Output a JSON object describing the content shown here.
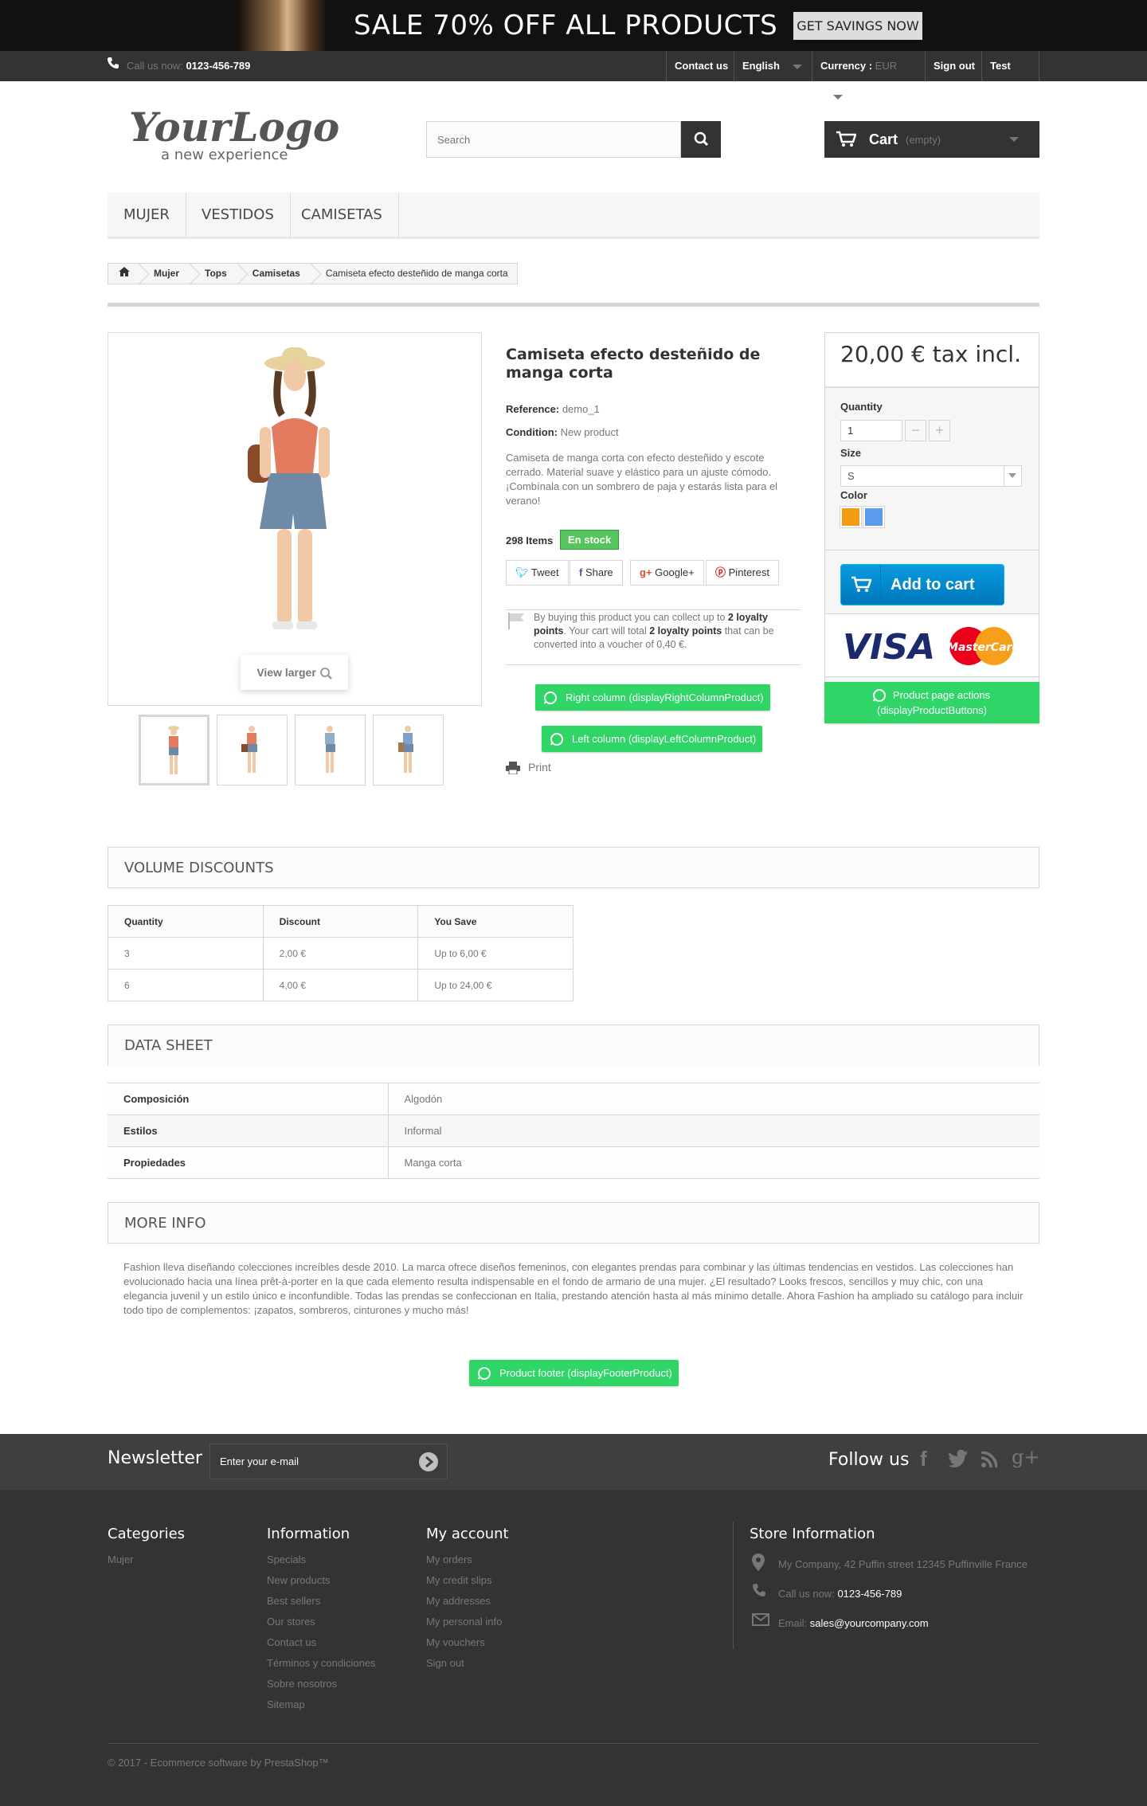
{
  "banner": {
    "text": "SALE 70% OFF ALL PRODUCTS",
    "button": "GET SAVINGS NOW"
  },
  "topbar": {
    "call_label": "Call us now:",
    "phone": "0123-456-789",
    "contact": "Contact us",
    "language": "English",
    "currency_label": "Currency :",
    "currency_value": "EUR",
    "signout": "Sign out",
    "user": "Test Test"
  },
  "header": {
    "logo_main": "YourLogo",
    "logo_tagline": "a new experience",
    "search_placeholder": "Search",
    "cart_label": "Cart",
    "cart_status": "(empty)"
  },
  "menu": [
    "MUJER",
    "VESTIDOS",
    "CAMISETAS"
  ],
  "breadcrumb": [
    "Mujer",
    "Tops",
    "Camisetas",
    "Camiseta efecto desteñido de manga corta"
  ],
  "product": {
    "title": "Camiseta efecto desteñido de manga corta",
    "reference_label": "Reference:",
    "reference": "demo_1",
    "condition_label": "Condition:",
    "condition": "New product",
    "description": "Camiseta de manga corta con efecto desteñido y escote cerrado. Material suave y elástico para un ajuste cómodo. ¡Combínala con un sombrero de paja y estarás lista para el verano!",
    "items": "298 Items",
    "stock": "En stock",
    "share": [
      "Tweet",
      "Share",
      "Google+",
      "Pinterest"
    ],
    "loyalty_1": "By buying this product you can collect up to",
    "loyalty_points1": "2 loyalty points",
    "loyalty_2": ". Your cart will total",
    "loyalty_points2": "2 loyalty points",
    "loyalty_3": "that can be converted into a voucher of 0,40 €.",
    "hook_right": "Right column (displayRightColumnProduct)",
    "hook_left": "Left column (displayLeftColumnProduct)",
    "print": "Print",
    "view_larger": "View larger"
  },
  "buybox": {
    "price": "20,00 € tax incl.",
    "quantity_label": "Quantity",
    "quantity": "1",
    "size_label": "Size",
    "size": "S",
    "color_label": "Color",
    "colors": [
      "#f39c11",
      "#5d9cec"
    ],
    "add_to_cart": "Add to cart",
    "hook_buttons_1": "Product page actions",
    "hook_buttons_2": "(displayProductButtons)",
    "visa": "VISA",
    "mastercard": "MasterCard"
  },
  "volume": {
    "title": "VOLUME DISCOUNTS",
    "headers": [
      "Quantity",
      "Discount",
      "You Save"
    ],
    "rows": [
      [
        "3",
        "2,00 €",
        "Up to 6,00 €"
      ],
      [
        "6",
        "4,00 €",
        "Up to 24,00 €"
      ]
    ]
  },
  "datasheet": {
    "title": "DATA SHEET",
    "rows": [
      [
        "Composición",
        "Algodón"
      ],
      [
        "Estilos",
        "Informal"
      ],
      [
        "Propiedades",
        "Manga corta"
      ]
    ]
  },
  "moreinfo": {
    "title": "MORE INFO",
    "text": "Fashion lleva diseñando colecciones increíbles desde 2010. La marca ofrece diseños femeninos, con elegantes prendas para combinar y las últimas tendencias en vestidos. Las colecciones han evolucionado hacia una línea prêt-à-porter en la que cada elemento resulta indispensable en el fondo de armario de una mujer. ¿El resultado? Looks frescos, sencillos y muy chic, con una elegancia juvenil y un estilo único e inconfundible. Todas las prendas se confeccionan en Italia, prestando atención hasta al más mínimo detalle. Ahora Fashion ha ampliado su catálogo para incluir todo tipo de complementos: ¡zapatos, sombreros, cinturones y mucho más!"
  },
  "footer_hook": "Product footer (displayFooterProduct)",
  "newsletter": {
    "title": "Newsletter",
    "placeholder": "Enter your e-mail",
    "follow": "Follow us"
  },
  "footer": {
    "categories": {
      "title": "Categories",
      "links": [
        "Mujer"
      ]
    },
    "information": {
      "title": "Information",
      "links": [
        "Specials",
        "New products",
        "Best sellers",
        "Our stores",
        "Contact us",
        "Términos y condiciones",
        "Sobre nosotros",
        "Sitemap"
      ]
    },
    "account": {
      "title": "My account",
      "links": [
        "My orders",
        "My credit slips",
        "My addresses",
        "My personal info",
        "My vouchers",
        "Sign out"
      ]
    },
    "store": {
      "title": "Store Information",
      "address": "My Company, 42 Puffin street 12345 Puffinville France",
      "call_label": "Call us now:",
      "phone": "0123-456-789",
      "email_label": "Email:",
      "email": "sales@yourcompany.com"
    },
    "copyright": "© 2017 - Ecommerce software by PrestaShop™"
  }
}
